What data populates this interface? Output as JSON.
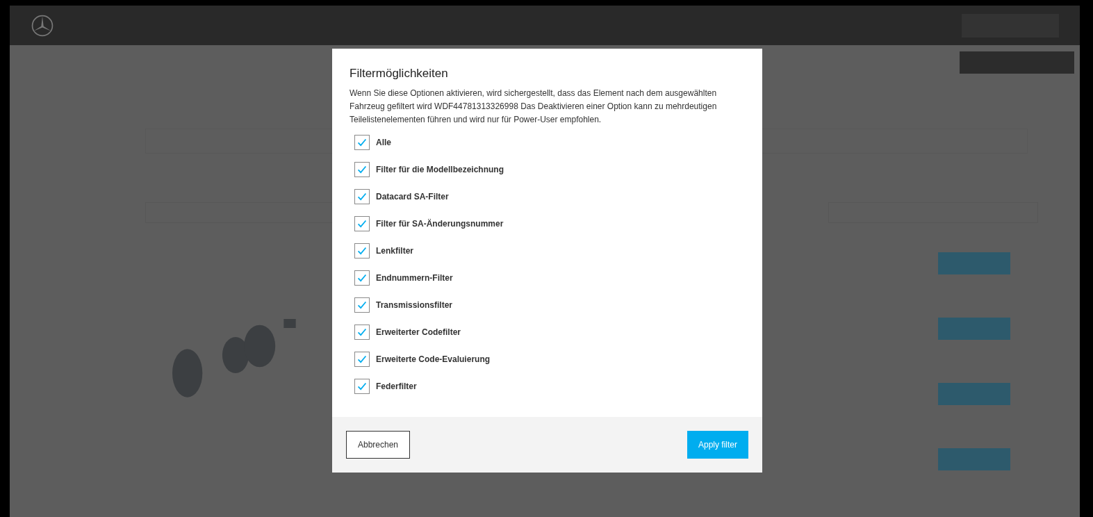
{
  "dialog": {
    "title": "Filtermöglichkeiten",
    "description": "Wenn Sie diese Optionen aktivieren, wird sichergestellt, dass das Element nach dem ausgewählten Fahrzeug gefiltert wird WDF44781313326998 Das Deaktivieren einer Option kann zu mehrdeutigen Teilelistenelementen führen und wird nur für Power-User empfohlen.",
    "options": [
      {
        "label": "Alle",
        "checked": true
      },
      {
        "label": "Filter für die Modellbezeichnung",
        "checked": true
      },
      {
        "label": "Datacard SA-Filter",
        "checked": true
      },
      {
        "label": "Filter für SA-Änderungsnummer",
        "checked": true
      },
      {
        "label": "Lenkfilter",
        "checked": true
      },
      {
        "label": "Endnummern-Filter",
        "checked": true
      },
      {
        "label": "Transmissionsfilter",
        "checked": true
      },
      {
        "label": "Erweiterter Codefilter",
        "checked": true
      },
      {
        "label": "Erweiterte Code-Evaluierung",
        "checked": true
      },
      {
        "label": "Federfilter",
        "checked": true
      }
    ],
    "buttons": [
      {
        "kind": "secondary",
        "label": "Abbrechen"
      },
      {
        "kind": "primary",
        "label": "Apply filter"
      }
    ]
  }
}
